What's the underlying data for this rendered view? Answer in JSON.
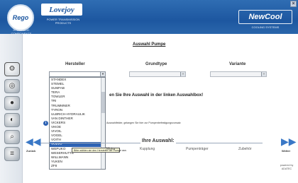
{
  "header": {
    "logo_text": "Rego",
    "logo_caption": "HYDRAULIC COMPONENTS",
    "lovejoy": "Lovejoy",
    "lovejoy_tag": "POWER TRANSMISSION PRODUCTS",
    "newcool": "NewCool",
    "newcool_tag": "COOLING SYSTEMS",
    "close": "×"
  },
  "page_title": "Auswahl Pumpe",
  "columns": {
    "hersteller": "Hersteller",
    "grundtype": "Grundtype",
    "variante": "Variante"
  },
  "selects": {
    "hersteller_value": "",
    "grundtype_value": "",
    "variante_value": ""
  },
  "dropdown_items": [
    "STANDEX",
    "STEMEL",
    "SUMFAB",
    "TERA",
    "TOWLER",
    "TRI",
    "TRUMMNER",
    "TYRON",
    "ULBRICH-HYDRAULIK",
    "VAN DINTHER",
    "VICKERS",
    "VIKOE",
    "VIVOIL",
    "VOGEL",
    "VOITH",
    "VOLVO",
    "WEPUKO",
    "WESERHUTTE",
    "WILLMANN",
    "YUKEN",
    "ZF8"
  ],
  "dropdown_selected_index": 15,
  "message": "en Sie Ihre Auswahl in der linken Auswahlbox!",
  "hint": "Auswahlfelder, gelangen Sie hier zur Pumpenbefestigungsvorsatz",
  "tooltip": "Bitte wählen sie den Hersteller der Pumpe aus",
  "nav": {
    "auswahl_label": "Ihre Auswahl:",
    "motor": "Motor",
    "kupplung": "Kupplung",
    "pumpentraeger": "Pumpenträger",
    "zubehoer": "Zubehör",
    "zurueck": "Zurück",
    "weiter": "Weiter",
    "back_arrow": "◀◀",
    "forward_arrow": "▶▶"
  },
  "brand_bottom": "powered by ADATEC",
  "colors": {
    "header_blue": "#1d57a0",
    "selection_blue": "#2d62b3",
    "nav_arrow": "#3a78c6"
  }
}
